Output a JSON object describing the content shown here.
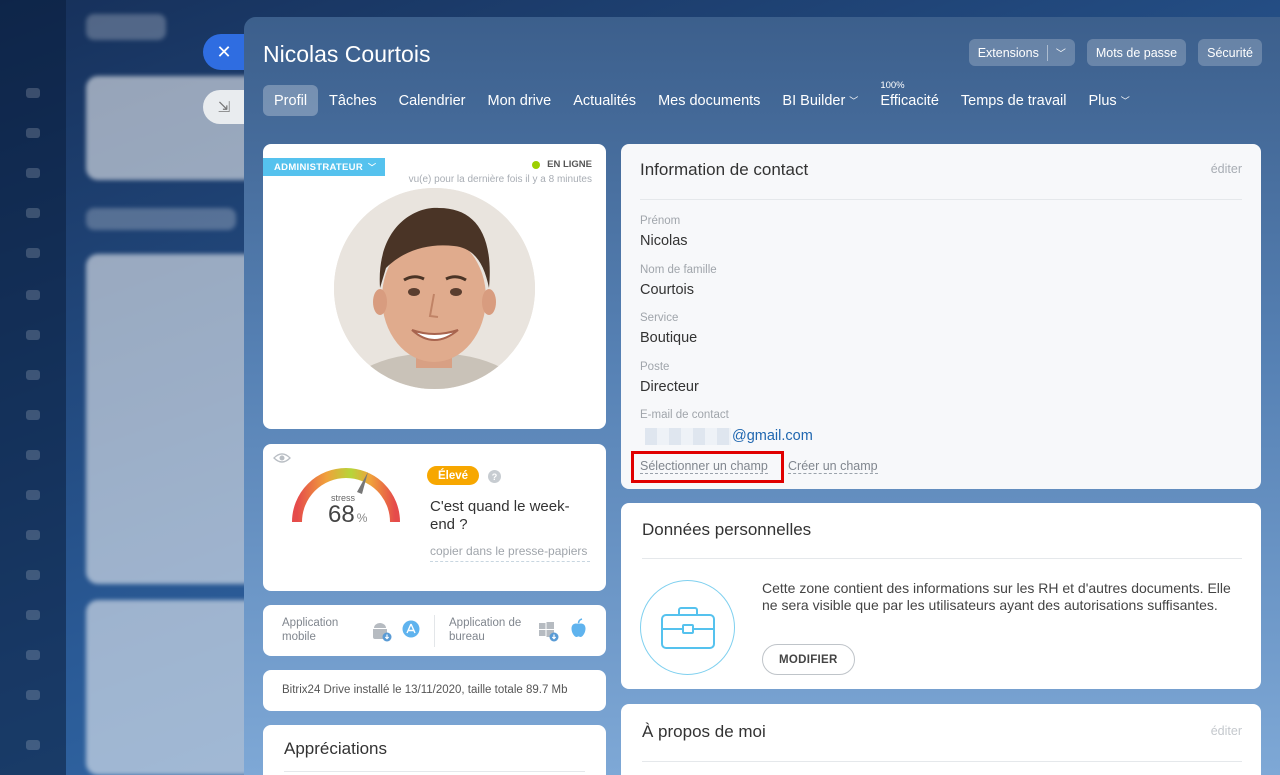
{
  "profile": {
    "name": "Nicolas Courtois",
    "role_badge": "ADMINISTRATEUR",
    "status": "EN LIGNE",
    "last_seen": "vu(e) pour la dernière fois il y a 8 minutes"
  },
  "top_actions": {
    "extensions": "Extensions",
    "passwords": "Mots de passe",
    "security": "Sécurité"
  },
  "tabs": [
    {
      "label": "Profil",
      "active": true
    },
    {
      "label": "Tâches"
    },
    {
      "label": "Calendrier"
    },
    {
      "label": "Mon drive"
    },
    {
      "label": "Actualités"
    },
    {
      "label": "Mes documents"
    },
    {
      "label": "BI Builder",
      "dropdown": true
    },
    {
      "label": "Efficacité",
      "superscript": "100%"
    },
    {
      "label": "Temps de travail"
    },
    {
      "label": "Plus",
      "dropdown": true
    }
  ],
  "stress": {
    "label": "stress",
    "value": "68",
    "unit": "%",
    "level": "Élevé",
    "question": "C'est quand le week-end ?",
    "copy": "copier dans le presse-papiers"
  },
  "apps": {
    "mobile": "Application mobile",
    "desktop": "Application de bureau"
  },
  "drive": {
    "text": "Bitrix24 Drive installé le 13/11/2020, taille totale 89.7 Mb"
  },
  "appreciations": {
    "title": "Appréciations"
  },
  "contact": {
    "title": "Information de contact",
    "edit": "éditer",
    "fields": [
      {
        "label": "Prénom",
        "value": "Nicolas"
      },
      {
        "label": "Nom de famille",
        "value": "Courtois"
      },
      {
        "label": "Service",
        "value": "Boutique"
      },
      {
        "label": "Poste",
        "value": "Directeur"
      },
      {
        "label": "E-mail de contact",
        "value": "@gmail.com"
      }
    ],
    "select_field": "Sélectionner un champ",
    "create_field": "Créer un champ"
  },
  "personal": {
    "title": "Données personnelles",
    "text": "Cette zone contient des informations sur les RH et d'autres documents. Elle ne sera visible que par les utilisateurs ayant des autorisations suffisantes.",
    "modify": "MODIFIER"
  },
  "about": {
    "title": "À propos de moi",
    "edit": "éditer"
  },
  "colors": {
    "accent": "#2f6de1",
    "online": "#9dcf00",
    "badge": "#55c2ee",
    "warning": "#f7a700",
    "highlight": "#e00000"
  }
}
